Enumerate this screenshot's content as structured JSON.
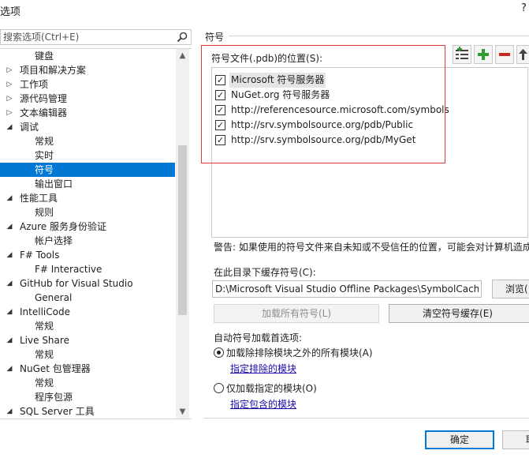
{
  "window": {
    "title": "选项",
    "help": "?"
  },
  "search": {
    "placeholder": "搜索选项(Ctrl+E)"
  },
  "tree": {
    "items": [
      {
        "label": "键盘",
        "indent": 1,
        "arrow": ""
      },
      {
        "label": "项目和解决方案",
        "indent": 0,
        "arrow": "collapsed"
      },
      {
        "label": "工作项",
        "indent": 0,
        "arrow": "collapsed"
      },
      {
        "label": "源代码管理",
        "indent": 0,
        "arrow": "collapsed"
      },
      {
        "label": "文本编辑器",
        "indent": 0,
        "arrow": "collapsed"
      },
      {
        "label": "调试",
        "indent": 0,
        "arrow": "expanded"
      },
      {
        "label": "常规",
        "indent": 1,
        "arrow": ""
      },
      {
        "label": "实时",
        "indent": 1,
        "arrow": ""
      },
      {
        "label": "符号",
        "indent": 1,
        "arrow": "",
        "selected": true
      },
      {
        "label": "输出窗口",
        "indent": 1,
        "arrow": ""
      },
      {
        "label": "性能工具",
        "indent": 0,
        "arrow": "expanded"
      },
      {
        "label": "规则",
        "indent": 1,
        "arrow": ""
      },
      {
        "label": "Azure 服务身份验证",
        "indent": 0,
        "arrow": "expanded"
      },
      {
        "label": "帐户选择",
        "indent": 1,
        "arrow": ""
      },
      {
        "label": "F# Tools",
        "indent": 0,
        "arrow": "expanded"
      },
      {
        "label": "F# Interactive",
        "indent": 1,
        "arrow": ""
      },
      {
        "label": "GitHub for Visual Studio",
        "indent": 0,
        "arrow": "expanded"
      },
      {
        "label": "General",
        "indent": 1,
        "arrow": ""
      },
      {
        "label": "IntelliCode",
        "indent": 0,
        "arrow": "expanded"
      },
      {
        "label": "常规",
        "indent": 1,
        "arrow": ""
      },
      {
        "label": "Live Share",
        "indent": 0,
        "arrow": "expanded"
      },
      {
        "label": "常规",
        "indent": 1,
        "arrow": ""
      },
      {
        "label": "NuGet 包管理器",
        "indent": 0,
        "arrow": "expanded"
      },
      {
        "label": "常规",
        "indent": 1,
        "arrow": ""
      },
      {
        "label": "程序包源",
        "indent": 1,
        "arrow": ""
      },
      {
        "label": "SQL Server 工具",
        "indent": 0,
        "arrow": "expanded"
      }
    ]
  },
  "symbols": {
    "section_title": "符号",
    "locations_label": "符号文件(.pdb)的位置(S):",
    "locations": [
      {
        "text": "Microsoft 符号服务器",
        "checked": true
      },
      {
        "text": "NuGet.org 符号服务器",
        "checked": true
      },
      {
        "text": "http://referencesource.microsoft.com/symbols",
        "checked": true
      },
      {
        "text": "http://srv.symbolsource.org/pdb/Public",
        "checked": true
      },
      {
        "text": "http://srv.symbolsource.org/pdb/MyGet",
        "checked": true
      }
    ],
    "warning": "警告: 如果使用的符号文件来自未知或不受信任的位置，可能会对计算机造成",
    "cache_label": "在此目录下缓存符号(C):",
    "cache_path": "D:\\Microsoft Visual Studio Offline Packages\\SymbolCache",
    "browse_label": "浏览(",
    "load_all_label": "加载所有符号(L)",
    "clear_cache_label": "清空符号缓存(E)",
    "auto_load_label": "自动符号加载首选项:",
    "option_all_label": "加载除排除模块之外的所有模块(A)",
    "exclude_link": "指定排除的模块",
    "option_specified_label": "仅加载指定的模块(O)",
    "include_link": "指定包含的模块"
  },
  "footer": {
    "ok_label": "确定",
    "cancel_label": "取"
  },
  "colors": {
    "selection": "#0078d4",
    "highlight_border": "#e03a3a",
    "add": "#2e9e2e",
    "remove": "#c42b1c"
  }
}
